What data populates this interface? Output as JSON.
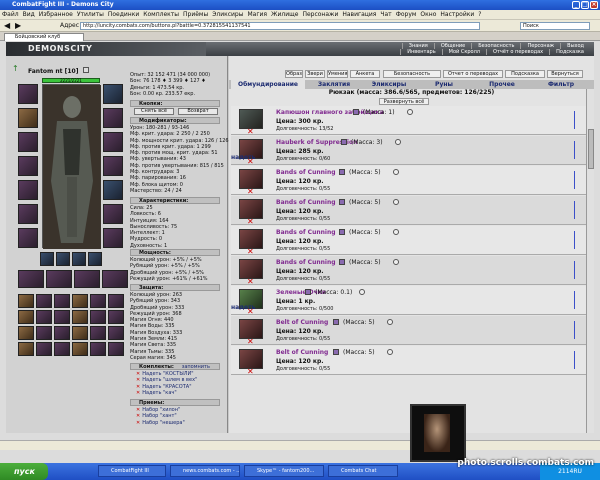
{
  "window": {
    "title": "CombatFight III - Demons City"
  },
  "menu": [
    "Файл",
    "Вид",
    "Избранное",
    "Утилиты",
    "Поединки",
    "Комплекты",
    "Приёмы",
    "Эликсиры",
    "Магия",
    "Жилище",
    "Персонажи",
    "Навигация",
    "Чат",
    "Форум",
    "Окно",
    "Настройки",
    "?"
  ],
  "address": {
    "label": "Адрес",
    "url": "http://luncity.combats.com/buttons.pl?battle=0.372815541137541",
    "search_placeholder": "Поиск"
  },
  "browser_tab": "Бойцовский клуб",
  "logo": "DEMONSCITY",
  "topnav": {
    "row1": [
      "Знания",
      "Общение",
      "Безопасность",
      "Персонаж",
      "Выход"
    ],
    "row2": [
      "Инвентарь",
      "Мой Скролл",
      "Отчёт о переводах",
      "Подсказка"
    ]
  },
  "character": {
    "name": "Fantom nt",
    "level": "[10]",
    "hp": "2221/2221",
    "stats_top": [
      "Опыт: 32 152 471 (34 000 000)",
      "Бон:  76 178 ♦  3 399 ♦  127 ♦",
      "Деньги: 1 473.54 кр.",
      "Бон:  0.00 кр.  233.57 екр."
    ],
    "buttons": {
      "kickoff": "Снять всё",
      "return": "Возврат"
    },
    "sections": {
      "buttons": "Кнопки:",
      "modifiers": "Модификаторы:",
      "characteristics": "Характеристики:",
      "mastery": "Мощность:",
      "protection": "Защита:",
      "sets": "Комплекты:",
      "tricks": "Приемы:"
    },
    "set_save": "запомнить",
    "modifiers": [
      "Урон: 180-281 / 93-146",
      "Мф. крит. удара: 2 250 / 2 250",
      "Мф. мощности крит. удара: 126 / 126",
      "Мф. против крит. удара: 1 299",
      "Мф. против мощ. крит. удара: 51",
      "Мф. увертывания: 43",
      "Мф. против увертывания: 815 / 815",
      "Мф. контрудара: 3",
      "Мф. парирования: 16",
      "Мф. блока щитом: 0",
      "Мастерство: 24 / 24"
    ],
    "characteristics": [
      "Сила: 25",
      "Ловкость: 6",
      "Интуиция: 164",
      "Выносливость: 75",
      "Интеллект: 1",
      "Мудрость: 0",
      "Духовность: 1"
    ],
    "mastery": [
      "Колющий урон: +5% / +5%",
      "Рубящий урон: +5% / +5%",
      "Дробящий урон: +5% / +5%",
      "Режущий урон: +61% / +61%"
    ],
    "protection": [
      "Колющий урон: 263",
      "Рубящий урон: 343",
      "Дробящий урон: 333",
      "Режущий урон: 368",
      "Магия Огня: 440",
      "Магия Воды: 335",
      "Магия Воздуха: 333",
      "Магия Земли: 415",
      "Магия Света: 335",
      "Магия Тьмы: 335",
      "Серая магия: 345"
    ],
    "sets": [
      "Надеть \"КОСТЫЛИ\"",
      "Надеть \"шлем в вех\"",
      "Надеть \"КРАСОТА\"",
      "Надеть \"кач\""
    ],
    "tricks": [
      "Набор \"хилон\"",
      "Набор \"хант\"",
      "Набор \"нешера\""
    ]
  },
  "right": {
    "top_buttons": [
      "Образ",
      "Звери",
      "Умения",
      "Анкета",
      "Безопасность",
      "Отчет о переводах",
      "Подсказка",
      "Вернуться"
    ],
    "tabs": [
      "Обмундирование",
      "Заклятия",
      "Эликсиры",
      "Руны",
      "Прочее",
      "Фильтр"
    ],
    "backpack": "Рюкзак (масса: 386.6/565, предметов: 126/225)",
    "expand": "Развернуть всё",
    "wear": "надеть",
    "items": [
      {
        "name": "Капюшон главного забойщика",
        "weight": "(Масса: 1)",
        "price": "Цена: 300 кр.",
        "dur": "Долговечность: 13/52",
        "color": "tan"
      },
      {
        "name": "Hauberk of Suppression",
        "weight": "(Масса: 3)",
        "price": "Цена: 285 кр.",
        "dur": "Долговечность: 0/60",
        "color": "red"
      },
      {
        "name": "Bands of Cunning",
        "weight": "(Масса: 5)",
        "price": "Цена: 120 кр.",
        "dur": "Долговечность: 0/55",
        "color": "red"
      },
      {
        "name": "Bands of Cunning",
        "weight": "(Масса: 5)",
        "price": "Цена: 120 кр.",
        "dur": "Долговечность: 0/55",
        "color": "red"
      },
      {
        "name": "Bands of Cunning",
        "weight": "(Масса: 5)",
        "price": "Цена: 120 кр.",
        "dur": "Долговечность: 0/55",
        "color": "red"
      },
      {
        "name": "Bands of Cunning",
        "weight": "(Масса: 5)",
        "price": "Цена: 120 кр.",
        "dur": "Долговечность: 0/55",
        "color": "red"
      },
      {
        "name": "Зеленые Очки",
        "weight": "(Масса: 0.1)",
        "price": "Цена: 1 кр.",
        "dur": "Долговечность: 0/500",
        "color": "green"
      },
      {
        "name": "Belt of Cunning",
        "weight": "(Масса: 5)",
        "price": "Цена: 120 кр.",
        "dur": "Долговечность: 0/55",
        "color": "red"
      },
      {
        "name": "Belt of Cunning",
        "weight": "(Масса: 5)",
        "price": "Цена: 120 кр.",
        "dur": "Долговечность: 0/55",
        "color": "red"
      }
    ]
  },
  "taskbar": {
    "start": "пуск",
    "buttons": [
      "CombatFight III",
      "news.combats.com - ...",
      "Skype™ - fantom200...",
      "Combats Chat"
    ],
    "clock": "2114RU"
  },
  "watermark": "photo.scrolls.combats.com"
}
